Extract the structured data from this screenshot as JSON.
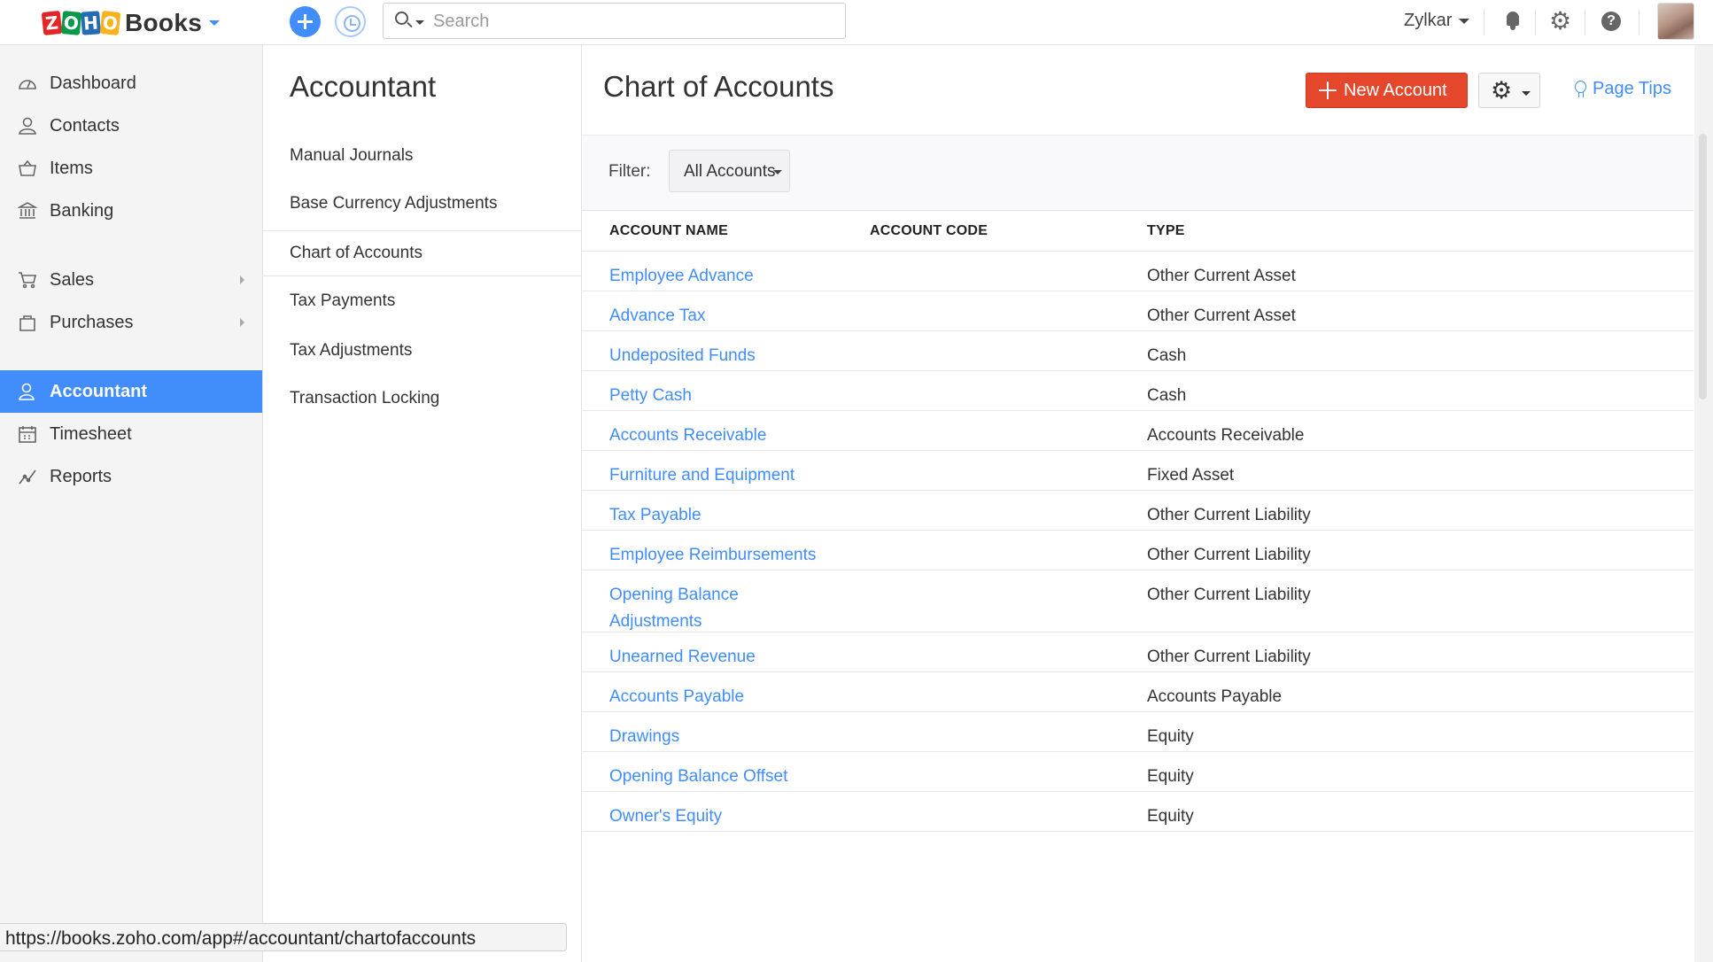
{
  "app": {
    "brand_letters": [
      "Z",
      "O",
      "H",
      "O"
    ],
    "brand_name": "Books"
  },
  "search": {
    "placeholder": "Search",
    "value": ""
  },
  "header": {
    "org_name": "Zylkar"
  },
  "sidebar": {
    "items": [
      {
        "label": "Dashboard",
        "icon": "dashboard-icon"
      },
      {
        "label": "Contacts",
        "icon": "contacts-icon"
      },
      {
        "label": "Items",
        "icon": "items-icon"
      },
      {
        "label": "Banking",
        "icon": "banking-icon"
      },
      {
        "label": "Sales",
        "icon": "sales-icon",
        "has_submenu": true
      },
      {
        "label": "Purchases",
        "icon": "purchases-icon",
        "has_submenu": true
      },
      {
        "label": "Accountant",
        "icon": "accountant-icon",
        "active": true
      },
      {
        "label": "Timesheet",
        "icon": "timesheet-icon"
      },
      {
        "label": "Reports",
        "icon": "reports-icon"
      }
    ]
  },
  "submenu": {
    "title": "Accountant",
    "items": [
      {
        "label": "Manual Journals"
      },
      {
        "label": "Base Currency Adjustments"
      },
      {
        "label": "Chart of Accounts",
        "active": true
      },
      {
        "label": "Tax Payments"
      },
      {
        "label": "Tax Adjustments"
      },
      {
        "label": "Transaction Locking"
      }
    ]
  },
  "main": {
    "title": "Chart of Accounts",
    "new_button_label": "New Account",
    "page_tips_label": "Page Tips",
    "filter": {
      "label": "Filter:",
      "value": "All Accounts"
    },
    "columns": [
      "ACCOUNT NAME",
      "ACCOUNT CODE",
      "TYPE"
    ],
    "rows": [
      {
        "name": "Employee Advance",
        "code": "",
        "type": "Other Current Asset"
      },
      {
        "name": "Advance Tax",
        "code": "",
        "type": "Other Current Asset"
      },
      {
        "name": "Undeposited Funds",
        "code": "",
        "type": "Cash"
      },
      {
        "name": "Petty Cash",
        "code": "",
        "type": "Cash"
      },
      {
        "name": "Accounts Receivable",
        "code": "",
        "type": "Accounts Receivable"
      },
      {
        "name": "Furniture and Equipment",
        "code": "",
        "type": "Fixed Asset"
      },
      {
        "name": "Tax Payable",
        "code": "",
        "type": "Other Current Liability"
      },
      {
        "name": "Employee Reimbursements",
        "code": "",
        "type": "Other Current Liability"
      },
      {
        "name": "Opening Balance Adjustments",
        "code": "",
        "type": "Other Current Liability"
      },
      {
        "name": "Unearned Revenue",
        "code": "",
        "type": "Other Current Liability"
      },
      {
        "name": "Accounts Payable",
        "code": "",
        "type": "Accounts Payable"
      },
      {
        "name": "Drawings",
        "code": "",
        "type": "Equity"
      },
      {
        "name": "Opening Balance Offset",
        "code": "",
        "type": "Equity"
      },
      {
        "name": "Owner's Equity",
        "code": "",
        "type": "Equity"
      }
    ]
  },
  "status_bar": {
    "url": "https://books.zoho.com/app#/accountant/chartofaccounts"
  },
  "colors": {
    "accent": "#408dfb",
    "primary_button": "#e4472c",
    "sidebar_bg": "#f4f4f5"
  }
}
